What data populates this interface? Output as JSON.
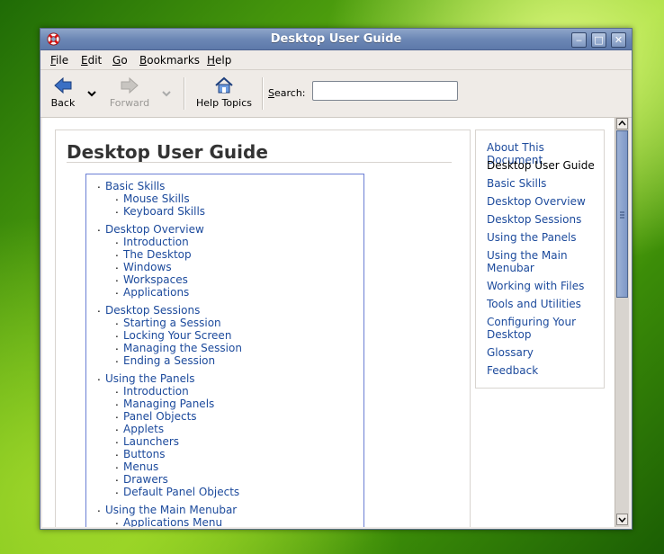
{
  "window": {
    "title": "Desktop User Guide"
  },
  "menubar": [
    {
      "key": "F",
      "rest": "ile"
    },
    {
      "key": "E",
      "rest": "dit"
    },
    {
      "key": "G",
      "rest": "o"
    },
    {
      "key": "B",
      "rest": "ookmarks"
    },
    {
      "key": "H",
      "rest": "elp"
    }
  ],
  "toolbar": {
    "back_label": "Back",
    "forward_label": "Forward",
    "help_topics_label": "Help Topics",
    "search_label_key": "S",
    "search_label_rest": "earch:",
    "search_value": ""
  },
  "page": {
    "title": "Desktop User Guide",
    "toc": [
      {
        "title": "Basic Skills",
        "items": [
          "Mouse Skills",
          "Keyboard Skills"
        ]
      },
      {
        "title": "Desktop Overview",
        "items": [
          "Introduction",
          "The Desktop",
          "Windows",
          "Workspaces",
          "Applications"
        ]
      },
      {
        "title": "Desktop Sessions",
        "items": [
          "Starting a Session",
          "Locking Your Screen",
          "Managing the Session",
          "Ending a Session"
        ]
      },
      {
        "title": "Using the Panels",
        "items": [
          "Introduction",
          "Managing Panels",
          "Panel Objects",
          "Applets",
          "Launchers",
          "Buttons",
          "Menus",
          "Drawers",
          "Default Panel Objects"
        ]
      },
      {
        "title": "Using the Main Menubar",
        "items": [
          "Applications Menu"
        ]
      }
    ]
  },
  "sidebar": {
    "items": [
      {
        "label": "About This Document",
        "current": false
      },
      {
        "label": "Desktop User Guide",
        "current": true
      },
      {
        "label": "Basic Skills",
        "current": false
      },
      {
        "label": "Desktop Overview",
        "current": false
      },
      {
        "label": "Desktop Sessions",
        "current": false
      },
      {
        "label": "Using the Panels",
        "current": false
      },
      {
        "label": "Using the Main Menubar",
        "current": false
      },
      {
        "label": "Working with Files",
        "current": false
      },
      {
        "label": "Tools and Utilities",
        "current": false
      },
      {
        "label": "Configuring Your Desktop",
        "current": false
      },
      {
        "label": "Glossary",
        "current": false
      },
      {
        "label": "Feedback",
        "current": false
      }
    ]
  },
  "colors": {
    "link": "#1c4a9c",
    "titlebar": "#6c87b5"
  }
}
